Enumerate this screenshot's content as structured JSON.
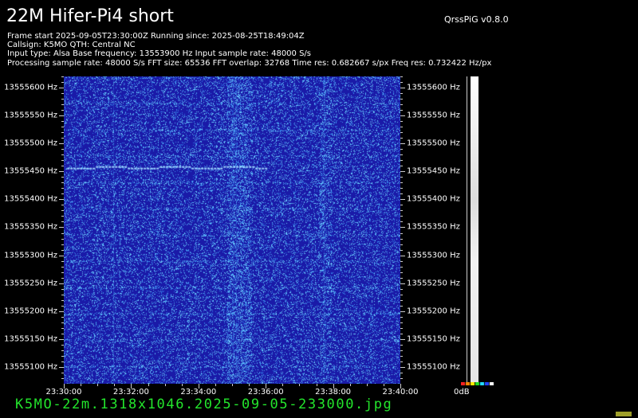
{
  "header": {
    "title": "22M Hifer-Pi4 short",
    "version": "QrssPiG v0.8.0"
  },
  "info": [
    "Frame start 2025-09-05T23:30:00Z Running since: 2025-08-25T18:49:04Z",
    "Callsign: K5MO QTH: Central NC",
    "Input type: Alsa Base frequency: 13553900 Hz Input sample rate: 48000 S/s",
    "Processing sample rate: 48000 S/s FFT size: 65536 FFT overlap: 32768 Time res: 0.682667 s/px Freq res: 0.732422 Hz/px"
  ],
  "freq_axis": {
    "labels": [
      "13555600 Hz",
      "13555550 Hz",
      "13555500 Hz",
      "13555450 Hz",
      "13555400 Hz",
      "13555350 Hz",
      "13555300 Hz",
      "13555250 Hz",
      "13555200 Hz",
      "13555150 Hz",
      "13555100 Hz"
    ],
    "values": [
      13555600,
      13555550,
      13555500,
      13555450,
      13555400,
      13555350,
      13555300,
      13555250,
      13555200,
      13555150,
      13555100
    ],
    "range_hz": [
      13555070,
      13555620
    ]
  },
  "time_axis": {
    "labels": [
      "23:30:00",
      "23:32:00",
      "23:34:00",
      "23:36:00",
      "23:38:00",
      "23:40:00"
    ],
    "range_minutes": [
      0,
      10
    ]
  },
  "waterfall": {
    "background_color": "#1a1aa8",
    "noise_color": "#4da3ff",
    "signal_color": "#9fd6ff",
    "signal": {
      "freq_hz": 13555458,
      "t_start_min": 0.1,
      "t_end_min": 6.0
    }
  },
  "db_scale": {
    "label": "0dB"
  },
  "footer": {
    "filename": "K5MO-22m.1318x1046.2025-09-05-233000.jpg",
    "filename_color": "#23e52c"
  }
}
